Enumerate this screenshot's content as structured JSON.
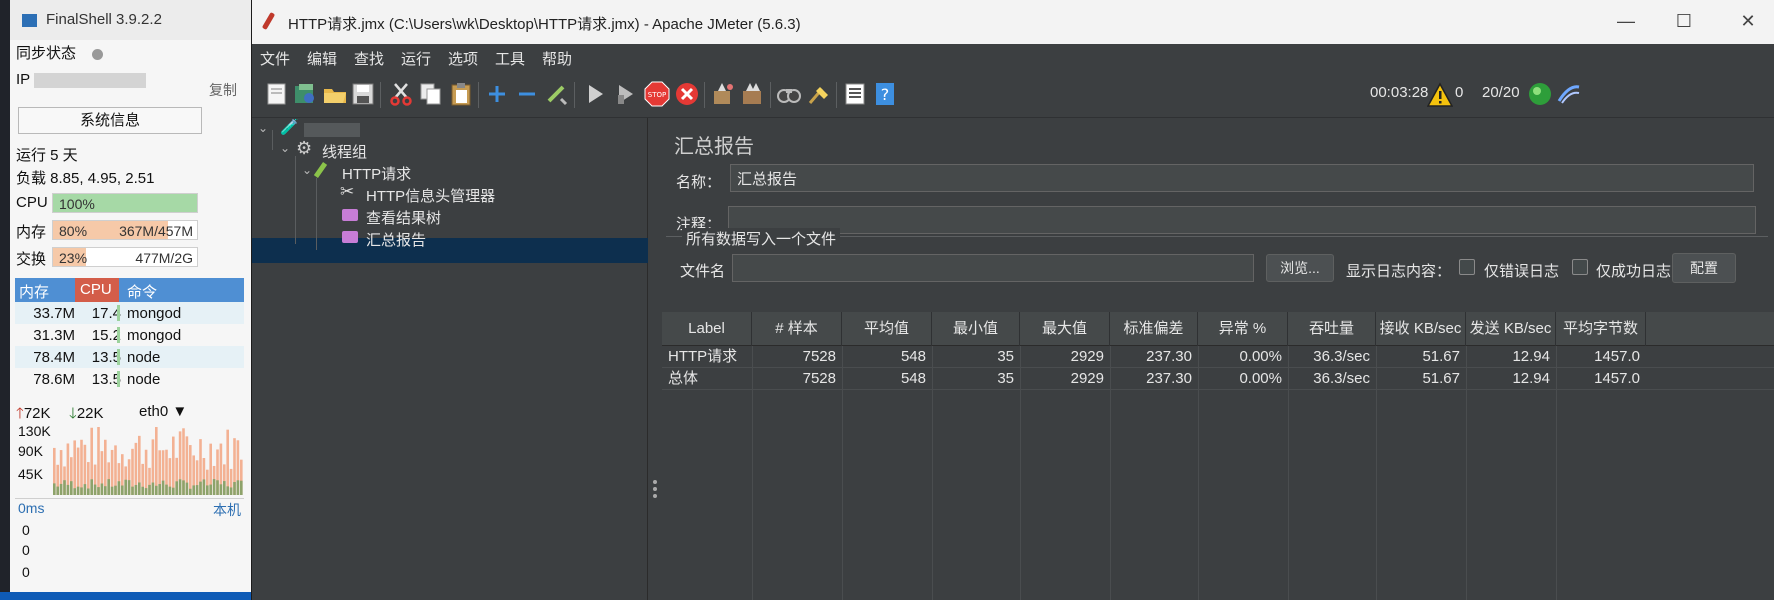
{
  "finalshell": {
    "title": "FinalShell 3.9.2.2",
    "sync_label": "同步状态",
    "ip_label": "IP",
    "copy_label": "复制",
    "sysinfo_button": "系统信息",
    "uptime": "运行 5 天",
    "load": "负载 8.85, 4.95, 2.51",
    "cpu": {
      "label": "CPU",
      "percent": "100%",
      "level": 1.0
    },
    "memory": {
      "label": "内存",
      "percent": "80%",
      "size": "367M/457M",
      "level": 0.8
    },
    "swap": {
      "label": "交换",
      "percent": "23%",
      "size": "477M/2G",
      "level": 0.23
    },
    "process_headers": {
      "mem": "内存",
      "cpu": "CPU",
      "cmd": "命令"
    },
    "processes": [
      {
        "mem": "33.7M",
        "cpu": "17.4",
        "cmd": "mongod"
      },
      {
        "mem": "31.3M",
        "cpu": "15.2",
        "cmd": "mongod"
      },
      {
        "mem": "78.4M",
        "cpu": "13.5",
        "cmd": "node"
      },
      {
        "mem": "78.6M",
        "cpu": "13.5",
        "cmd": "node"
      }
    ],
    "network": {
      "up": "72K",
      "down": "22K",
      "iface": "eth0"
    },
    "net_ticks": [
      "130K",
      "90K",
      "45K"
    ],
    "latency": {
      "label": "0ms",
      "host": "本机",
      "values": [
        "0",
        "0",
        "0"
      ]
    }
  },
  "jmeter": {
    "title": "HTTP请求.jmx (C:\\Users\\wk\\Desktop\\HTTP请求.jmx) - Apache JMeter (5.6.3)",
    "menu": [
      "文件",
      "编辑",
      "查找",
      "运行",
      "选项",
      "工具",
      "帮助"
    ],
    "timer": "00:03:28",
    "warnings": "0",
    "threads": "20/20",
    "tree": {
      "thread_group": "线程组",
      "sampler": "HTTP请求",
      "header_manager": "HTTP信息头管理器",
      "result_tree": "查看结果树",
      "summary": "汇总报告"
    },
    "panel": {
      "title": "汇总报告",
      "name_label": "名称：",
      "name_value": "汇总报告",
      "comment_label": "注释：",
      "file_section": "所有数据写入一个文件",
      "filename_label": "文件名",
      "browse_button": "浏览...",
      "log_label": "显示日志内容：",
      "errors_only": "仅错误日志",
      "success_only": "仅成功日志",
      "config_button": "配置"
    },
    "table": {
      "headers": [
        "Label",
        "# 样本",
        "平均值",
        "最小值",
        "最大值",
        "标准偏差",
        "异常 %",
        "吞吐量",
        "接收 KB/sec",
        "发送 KB/sec",
        "平均字节数"
      ],
      "rows": [
        [
          "HTTP请求",
          "7528",
          "548",
          "35",
          "2929",
          "237.30",
          "0.00%",
          "36.3/sec",
          "51.67",
          "12.94",
          "1457.0"
        ],
        [
          "总体",
          "7528",
          "548",
          "35",
          "2929",
          "237.30",
          "0.00%",
          "36.3/sec",
          "51.67",
          "12.94",
          "1457.0"
        ]
      ]
    }
  }
}
